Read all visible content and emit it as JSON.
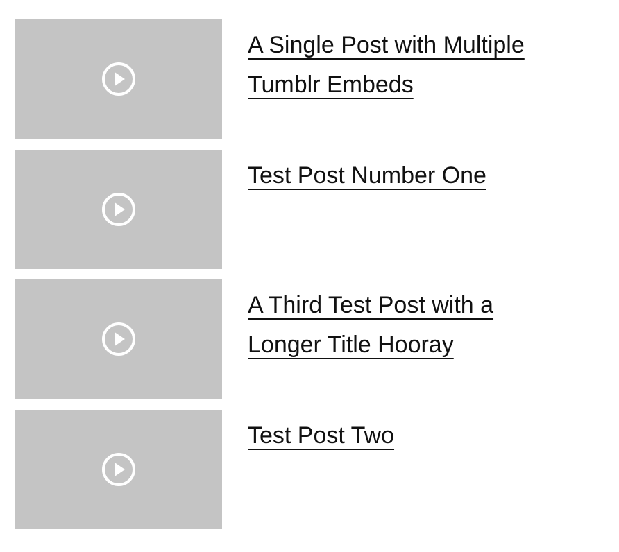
{
  "posts": [
    {
      "title": "A Single Post with Multiple Tumblr Embeds",
      "thumbnail_icon": "play-circle-icon"
    },
    {
      "title": "Test Post Number One",
      "thumbnail_icon": "play-circle-icon"
    },
    {
      "title": "A Third Test Post with a Longer Title Hooray",
      "thumbnail_icon": "play-circle-icon"
    },
    {
      "title": "Test Post Two",
      "thumbnail_icon": "play-circle-icon"
    }
  ],
  "colors": {
    "thumbnail_background": "#c4c4c4",
    "play_icon": "#ffffff",
    "title_text": "#111111",
    "page_background": "#ffffff"
  }
}
